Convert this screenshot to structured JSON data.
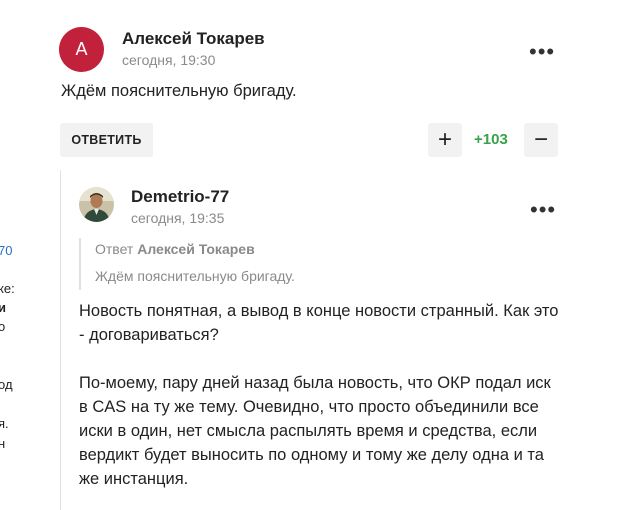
{
  "left_fragments": [
    {
      "text": "70",
      "color": "blue",
      "bold": false
    },
    {
      "text": "ке:",
      "color": "dark",
      "bold": false
    },
    {
      "text": "и",
      "color": "dark",
      "bold": true
    },
    {
      "text": "о",
      "color": "dark",
      "bold": false
    },
    {
      "text": "од",
      "color": "dark",
      "bold": false
    },
    {
      "text": "я.",
      "color": "dark",
      "bold": false
    },
    {
      "text": "н",
      "color": "dark",
      "bold": false
    }
  ],
  "comment1": {
    "avatar_letter": "A",
    "avatar_color": "#c1213a",
    "author": "Алексей Токарев",
    "time": "сегодня, 19:30",
    "text": "Ждём пояснительную бригаду.",
    "more_icon": "•••"
  },
  "actions": {
    "reply_label": "ОТВЕТИТЬ",
    "upvote_icon": "+",
    "score": "+103",
    "score_color": "#3aa34a",
    "downvote_icon": "−"
  },
  "comment2": {
    "author": "Demetrio-77",
    "time": "сегодня, 19:35",
    "more_icon": "•••",
    "quote": {
      "prefix": "Ответ",
      "author": "Алексей Токарев",
      "text": "Ждём пояснительную бригаду."
    },
    "paragraph1": "Новость понятная, а вывод в конце новости странный. Как это - договариваться?",
    "paragraph2": "По-моему, пару дней назад была новость, что ОКР подал иск в CAS на ту же тему. Очевидно, что просто объединили все иски в один, нет смысла распылять время и средства, если вердикт будет выносить по одному и тому же делу одна и та же инстанция."
  }
}
